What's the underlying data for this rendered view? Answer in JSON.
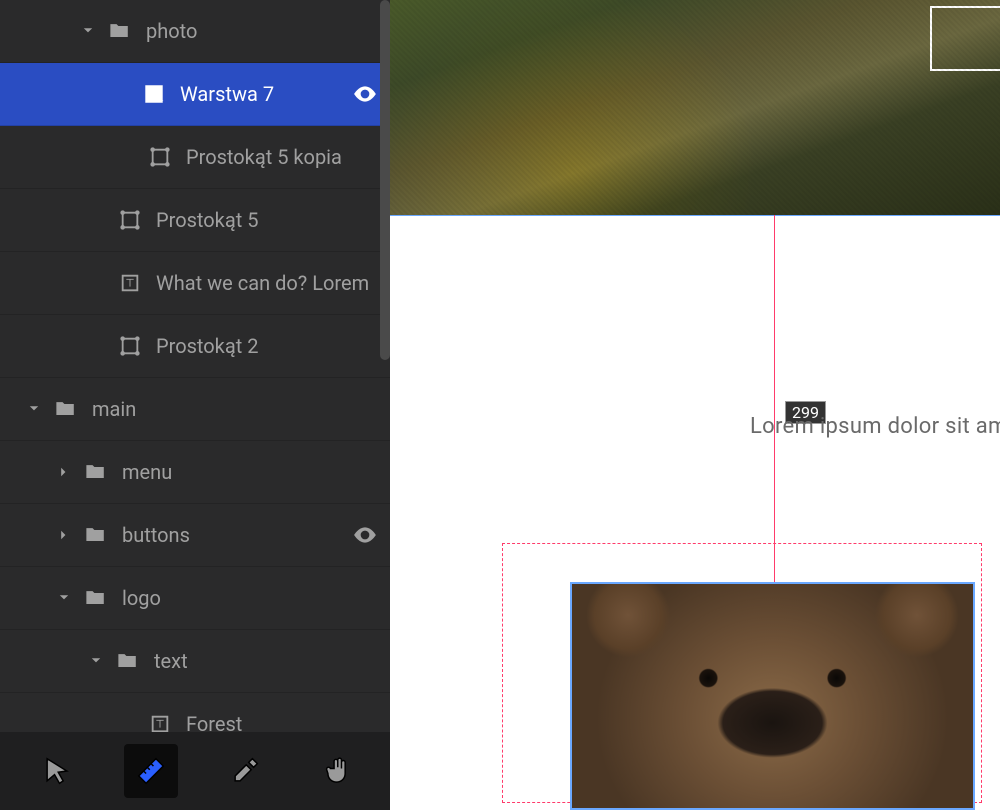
{
  "layers": [
    {
      "indent": 78,
      "expand": "down",
      "iconType": "folder",
      "label": "photo",
      "eye": false,
      "selected": false
    },
    {
      "indent": 112,
      "expand": "",
      "iconType": "image",
      "label": "Warstwa 7",
      "eye": true,
      "selected": true
    },
    {
      "indent": 118,
      "expand": "",
      "iconType": "shape",
      "label": "Prostokąt 5 kopia",
      "eye": false,
      "selected": false
    },
    {
      "indent": 88,
      "expand": "",
      "iconType": "shape",
      "label": "Prostokąt 5",
      "eye": false,
      "selected": false
    },
    {
      "indent": 88,
      "expand": "",
      "iconType": "text",
      "label": "What we can do? Lorem",
      "eye": false,
      "selected": false
    },
    {
      "indent": 88,
      "expand": "",
      "iconType": "shape",
      "label": "Prostokąt 2",
      "eye": false,
      "selected": false
    },
    {
      "indent": 24,
      "expand": "down",
      "iconType": "folder",
      "label": "main",
      "eye": false,
      "selected": false
    },
    {
      "indent": 54,
      "expand": "right",
      "iconType": "folder",
      "label": "menu",
      "eye": false,
      "selected": false
    },
    {
      "indent": 54,
      "expand": "right",
      "iconType": "folder",
      "label": "buttons",
      "eye": true,
      "selected": false
    },
    {
      "indent": 54,
      "expand": "down",
      "iconType": "folder",
      "label": "logo",
      "eye": false,
      "selected": false
    },
    {
      "indent": 86,
      "expand": "down",
      "iconType": "folder",
      "label": "text",
      "eye": false,
      "selected": false
    },
    {
      "indent": 118,
      "expand": "",
      "iconType": "text",
      "label": "Forest",
      "eye": false,
      "selected": false
    }
  ],
  "tools": [
    {
      "name": "pointer",
      "active": false
    },
    {
      "name": "ruler",
      "active": true
    },
    {
      "name": "eyedrop",
      "active": false
    },
    {
      "name": "hand",
      "active": false
    }
  ],
  "canvas": {
    "measureValue": "299",
    "loremText": "Lorem ipsum dolor sit amet"
  }
}
